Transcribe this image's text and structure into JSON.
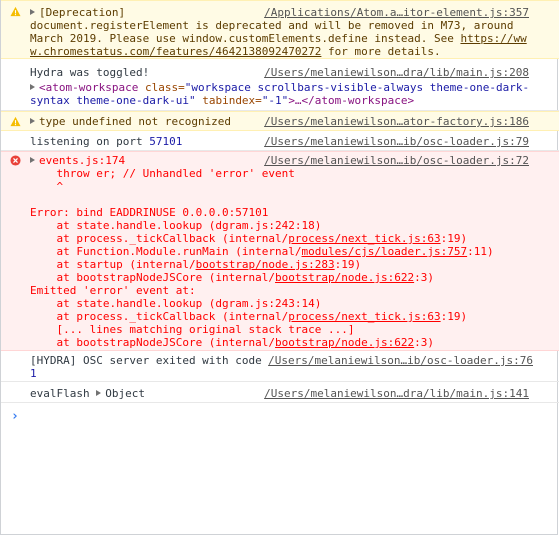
{
  "messages": {
    "deprecation": {
      "header": "[Deprecation]",
      "source": "/Applications/Atom.a…itor-element.js:357",
      "line1": "document.registerElement is deprecated and will be removed in M73, around",
      "line2": "March 2019. Please use window.customElements.define instead. See ",
      "link_part1": "https://ww",
      "link_part2": "w.chromestatus.com/features/4642138092470272",
      "line3_tail": " for more details."
    },
    "hydra_toggled": {
      "text": "Hydra was toggled!",
      "source": "/Users/melaniewilson…dra/lib/main.js:208",
      "tag_open": "<atom-workspace",
      "attr_class": " class=",
      "class_val1": "\"workspace scrollbars-visible-always theme-one-dark-",
      "class_val2": "syntax theme-one-dark-ui\"",
      "attr_tabindex": " tabindex=",
      "tabindex_val": "\"-1\"",
      "tag_mid": ">…</atom-workspace>"
    },
    "type_undefined": {
      "text": "type undefined not recognized",
      "source": "/Users/melaniewilson…ator-factory.js:186"
    },
    "listening": {
      "text": "listening on port ",
      "port": "57101",
      "source": "/Users/melaniewilson…ib/osc-loader.js:79"
    },
    "error": {
      "head": "events.js:174",
      "source": "/Users/melaniewilson…ib/osc-loader.js:72",
      "l1": "    throw er; // Unhandled 'error' event",
      "l2": "    ^",
      "l3": "Error: bind EADDRINUSE 0.0.0.0:57101",
      "s1a": "    at state.handle.lookup (dgram.js:242:18)",
      "s2a": "    at process._tickCallback (internal/",
      "s2u": "process/next_tick.js:63",
      "s2b": ":19)",
      "s3a": "    at Function.Module.runMain (internal/",
      "s3u": "modules/cjs/loader.js:757",
      "s3b": ":11)",
      "s4a": "    at startup (internal/",
      "s4u": "bootstrap/node.js:283",
      "s4b": ":19)",
      "s5a": "    at bootstrapNodeJSCore (internal/",
      "s5u": "bootstrap/node.js:622",
      "s5b": ":3)",
      "e1": "Emitted 'error' event at:",
      "t1": "    at state.handle.lookup (dgram.js:243:14)",
      "t2a": "    at process._tickCallback (internal/",
      "t2u": "process/next_tick.js:63",
      "t2b": ":19)",
      "t3": "    [... lines matching original stack trace ...]",
      "t4a": "    at bootstrapNodeJSCore (internal/",
      "t4u": "bootstrap/node.js:622",
      "t4b": ":3)"
    },
    "hydra_exit": {
      "text": "[HYDRA] OSC server exited with code ",
      "code": "1",
      "source": "/Users/melaniewilson…ib/osc-loader.js:76"
    },
    "evalflash": {
      "text": "evalFlash ",
      "obj": "Object",
      "source": "/Users/melaniewilson…dra/lib/main.js:141"
    }
  },
  "prompt_symbol": "›",
  "colors": {
    "warning_bg": "#fffbe5",
    "error_bg": "#fff0f0",
    "error_text": "#ff0000",
    "prompt": "#367cf1"
  }
}
